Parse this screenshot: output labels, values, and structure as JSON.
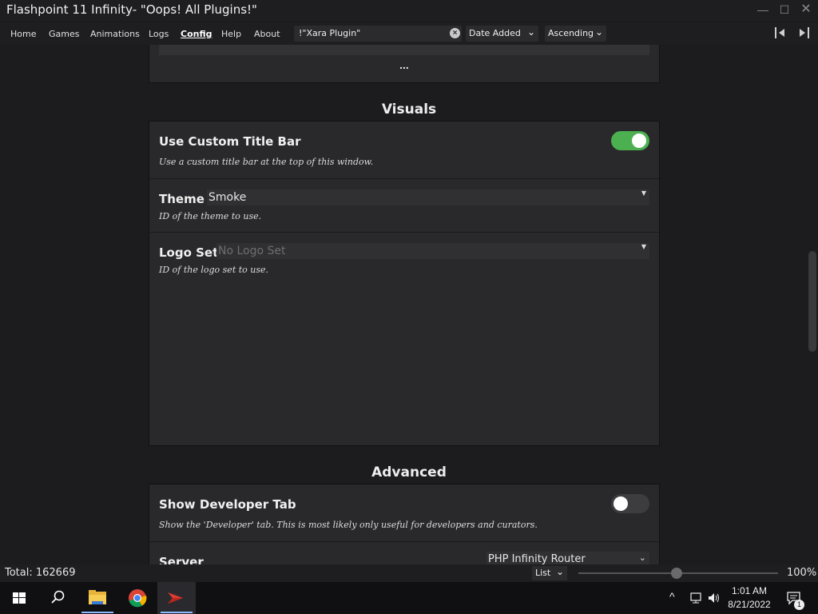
{
  "window": {
    "title": "Flashpoint 11 Infinity- \"Oops! All Plugins!\""
  },
  "menu": {
    "items": [
      "Home",
      "Games",
      "Animations",
      "Logs",
      "Config",
      "Help",
      "About"
    ],
    "active": "Config"
  },
  "search": {
    "value": "!\"Xara Plugin\""
  },
  "sort": {
    "field": "Date Added",
    "order": "Ascending"
  },
  "top_card": {
    "ellipsis": "..."
  },
  "visuals": {
    "heading": "Visuals",
    "custom_title_bar": {
      "title": "Use Custom Title Bar",
      "description": "Use a custom title bar at the top of this window.",
      "enabled": true
    },
    "theme": {
      "title": "Theme",
      "value": "Smoke",
      "description": "ID of the theme to use."
    },
    "logo_set": {
      "title": "Logo Set",
      "placeholder": "No Logo Set",
      "description": "ID of the logo set to use."
    }
  },
  "advanced": {
    "heading": "Advanced",
    "developer_tab": {
      "title": "Show Developer Tab",
      "description": "Show the 'Developer' tab. This is most likely only useful for developers and curators.",
      "enabled": false
    },
    "server": {
      "title": "Server",
      "value": "PHP Infinity Router"
    }
  },
  "status": {
    "total": "Total: 162669",
    "view": "List",
    "zoom": "100%"
  },
  "taskbar": {
    "time": "1:01 AM",
    "date": "8/21/2022",
    "notifications": "1"
  },
  "colors": {
    "toggle_on": "#4caf50",
    "toggle_off": "#3d3d3f",
    "background": "#1c1c1e",
    "card": "#29292b"
  }
}
